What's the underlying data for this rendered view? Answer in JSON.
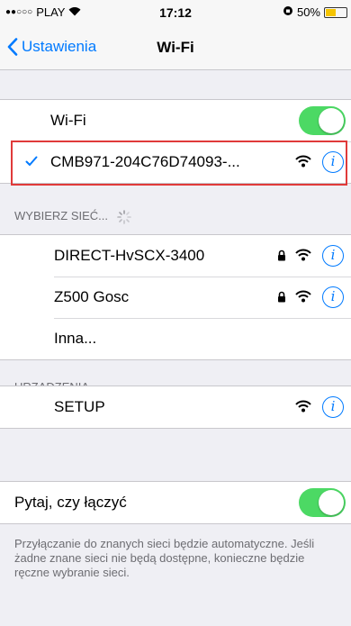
{
  "status_bar": {
    "signal_dots": "●●○○○",
    "carrier": "PLAY",
    "time": "17:12",
    "battery_percent": "50%",
    "battery_level": 0.5
  },
  "nav": {
    "back_label": "Ustawienia",
    "title": "Wi-Fi"
  },
  "wifi_toggle": {
    "label": "Wi-Fi",
    "on": true
  },
  "connected_network": {
    "name": "CMB971-204C76D74093-..."
  },
  "networks_section": {
    "header": "WYBIERZ SIEĆ...",
    "items": [
      {
        "name": "DIRECT-HvSCX-3400",
        "secured": true
      },
      {
        "name": "Z500 Gosc",
        "secured": true
      },
      {
        "name": "Inna..."
      }
    ]
  },
  "devices_section": {
    "header": "URZĄDZENIA",
    "items": [
      {
        "name": "SETUP"
      }
    ]
  },
  "ask_join": {
    "label": "Pytaj, czy łączyć",
    "on": true,
    "footer": "Przyłączanie do znanych sieci będzie automatyczne. Jeśli żadne znane sieci nie będą dostępne, konieczne będzie ręczne wybranie sieci."
  },
  "colors": {
    "accent": "#007aff",
    "toggle_on": "#4cd964",
    "highlight": "#e03a3a"
  }
}
